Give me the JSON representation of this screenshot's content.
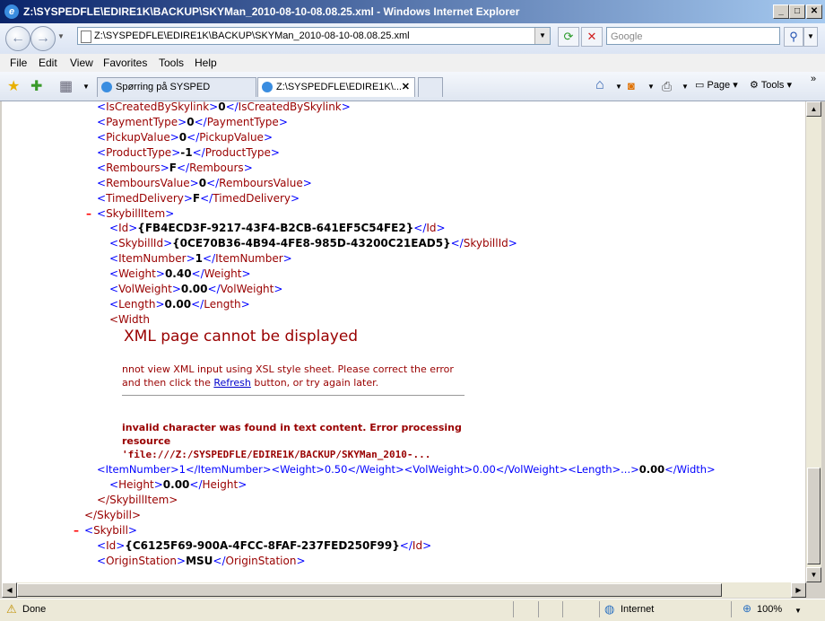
{
  "window": {
    "title": "Z:\\SYSPEDFLE\\EDIRE1K\\BACKUP\\SKYMan_2010-08-10-08.08.25.xml - Windows Internet Explorer",
    "minimize": "_",
    "maximize": "□",
    "close": "✕"
  },
  "address": {
    "url": "Z:\\SYSPEDFLE\\EDIRE1K\\BACKUP\\SKYMan_2010-08-10-08.08.25.xml"
  },
  "search": {
    "placeholder": "Google"
  },
  "menu": {
    "file": "File",
    "edit": "Edit",
    "view": "View",
    "favorites": "Favorites",
    "tools": "Tools",
    "help": "Help"
  },
  "tabs": [
    {
      "label": "Spørring på SYSPED"
    },
    {
      "label": "Z:\\SYSPEDFLE\\EDIRE1K\\..."
    }
  ],
  "commands": {
    "page": "Page",
    "tools": "Tools"
  },
  "xml": {
    "lines": [
      {
        "tag": "IsCreatedBySkylink",
        "value": "0"
      },
      {
        "tag": "PaymentType",
        "value": "0"
      },
      {
        "tag": "PickupValue",
        "value": "0"
      },
      {
        "tag": "ProductType",
        "value": "-1"
      },
      {
        "tag": "Rembours",
        "value": "F"
      },
      {
        "tag": "RemboursValue",
        "value": "0"
      },
      {
        "tag": "TimedDelivery",
        "value": "F"
      }
    ],
    "skybill_item_tag": "SkybillItem",
    "item_lines": [
      {
        "tag": "Id",
        "value": "{FB4ECD3F-9217-43F4-B2CB-641EF5C54FE2}"
      },
      {
        "tag": "SkybillId",
        "value": "{0CE70B36-4B94-4FE8-985D-43200C21EAD5}"
      },
      {
        "tag": "ItemNumber",
        "value": "1"
      },
      {
        "tag": "Weight",
        "value": "0.40"
      },
      {
        "tag": "VolWeight",
        "value": "0.00"
      },
      {
        "tag": "Length",
        "value": "0.00"
      }
    ],
    "width_open": "<Width",
    "long_line": "<ItemNumber>1</ItemNumber><Weight>0.50</Weight><VolWeight>0.00</VolWeight><Length>...>",
    "long_line_value": "0.00",
    "long_line_end": "</Width",
    "height_line": {
      "tag": "Height",
      "value": "0.00"
    },
    "close_item": "</SkybillItem>",
    "close_skybill": "</Skybill>",
    "skybill_tag": "Skybill",
    "last_lines": [
      {
        "tag": "Id",
        "value": "{C6125F69-900A-4FCC-8FAF-237FED250F99}"
      },
      {
        "tag": "OriginStation",
        "value": "MSU"
      }
    ]
  },
  "error": {
    "title": "XML page cannot be displayed",
    "line1": "nnot view XML input using XSL style sheet. Please correct the error",
    "line2_before": "and then click the ",
    "refresh": "Refresh",
    "line2_after": " button, or try again later.",
    "bold1": "invalid character was found in text content. Error processing",
    "bold2": "resource",
    "bold3": "'file:///Z:/SYSPEDFLE/EDIRE1K/BACKUP/SKYMan_2010-..."
  },
  "status": {
    "text": "Done",
    "zone": "Internet",
    "zoom": "100%"
  }
}
